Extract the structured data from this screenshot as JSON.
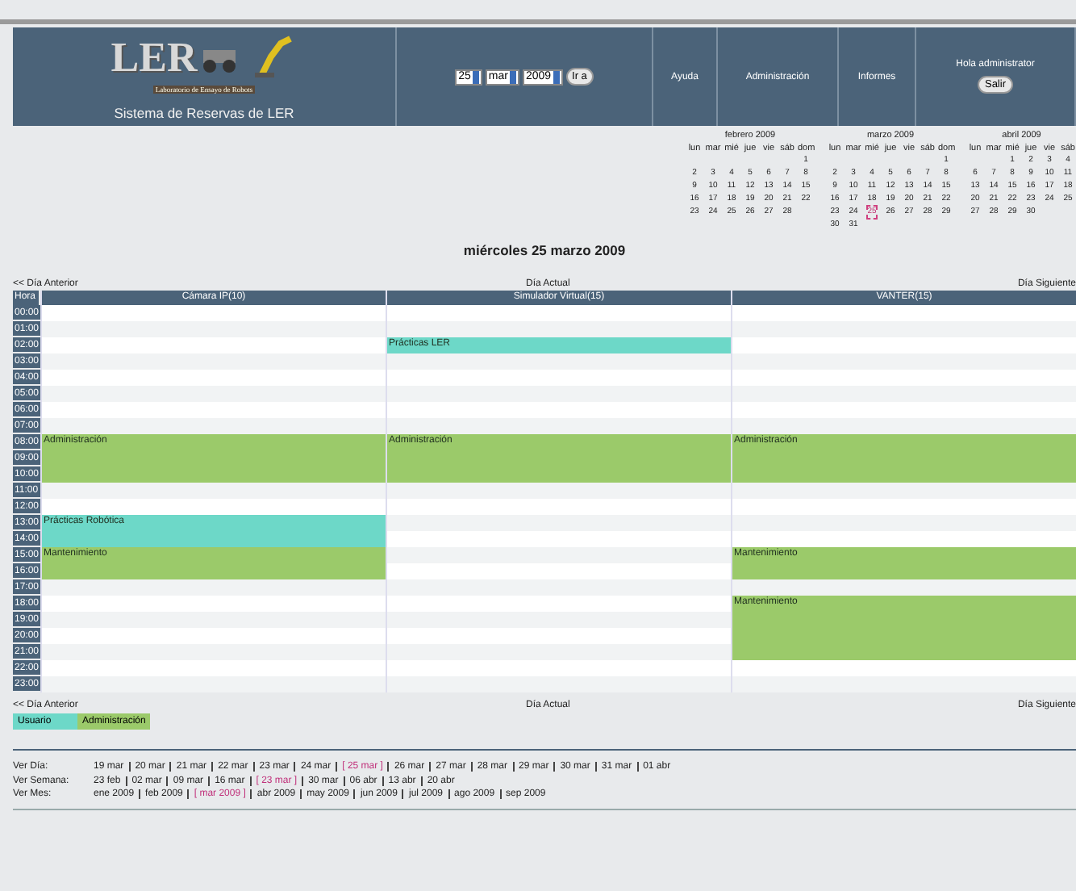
{
  "header": {
    "subtitle": "Sistema de Reservas de LER",
    "logo_text": "LER",
    "logo_caption": "Laboratorio de Ensayo de Robots",
    "date_picker": {
      "day": "25",
      "month": "mar",
      "year": "2009",
      "go": "Ir a"
    },
    "menu": [
      "Ayuda",
      "Administración",
      "Informes"
    ],
    "greeting": "Hola administrator",
    "logout": "Salir"
  },
  "calendars": [
    {
      "title": "febrero 2009",
      "weekdays": [
        "lun",
        "mar",
        "mié",
        "jue",
        "vie",
        "sáb",
        "dom"
      ],
      "weeks": [
        [
          {
            "day": "1",
            "selected": false
          }
        ],
        [
          {
            "day": "2",
            "selected": false
          },
          {
            "day": "3",
            "selected": false
          },
          {
            "day": "4",
            "selected": false
          },
          {
            "day": "5",
            "selected": false
          },
          {
            "day": "6",
            "selected": false
          },
          {
            "day": "7",
            "selected": false
          },
          {
            "day": "8",
            "selected": false
          }
        ],
        [
          {
            "day": "9",
            "selected": false
          },
          {
            "day": "10",
            "selected": false
          },
          {
            "day": "11",
            "selected": false
          },
          {
            "day": "12",
            "selected": false
          },
          {
            "day": "13",
            "selected": false
          },
          {
            "day": "14",
            "selected": false
          },
          {
            "day": "15",
            "selected": false
          }
        ],
        [
          {
            "day": "16",
            "selected": false
          },
          {
            "day": "17",
            "selected": false
          },
          {
            "day": "18",
            "selected": false
          },
          {
            "day": "19",
            "selected": false
          },
          {
            "day": "20",
            "selected": false
          },
          {
            "day": "21",
            "selected": false
          },
          {
            "day": "22",
            "selected": false
          }
        ],
        [
          {
            "day": "23",
            "selected": false
          },
          {
            "day": "24",
            "selected": false
          },
          {
            "day": "25",
            "selected": false
          },
          {
            "day": "26",
            "selected": false
          },
          {
            "day": "27",
            "selected": false
          },
          {
            "day": "28",
            "selected": false
          }
        ]
      ]
    },
    {
      "title": "marzo 2009",
      "weekdays": [
        "lun",
        "mar",
        "mié",
        "jue",
        "vie",
        "sáb",
        "dom"
      ],
      "weeks": [
        [
          {
            "day": "1",
            "selected": false
          }
        ],
        [
          {
            "day": "2",
            "selected": false
          },
          {
            "day": "3",
            "selected": false
          },
          {
            "day": "4",
            "selected": false
          },
          {
            "day": "5",
            "selected": false
          },
          {
            "day": "6",
            "selected": false
          },
          {
            "day": "7",
            "selected": false
          },
          {
            "day": "8",
            "selected": false
          }
        ],
        [
          {
            "day": "9",
            "selected": false
          },
          {
            "day": "10",
            "selected": false
          },
          {
            "day": "11",
            "selected": false
          },
          {
            "day": "12",
            "selected": false
          },
          {
            "day": "13",
            "selected": false
          },
          {
            "day": "14",
            "selected": false
          },
          {
            "day": "15",
            "selected": false
          }
        ],
        [
          {
            "day": "16",
            "selected": false
          },
          {
            "day": "17",
            "selected": false
          },
          {
            "day": "18",
            "selected": false
          },
          {
            "day": "19",
            "selected": false
          },
          {
            "day": "20",
            "selected": false
          },
          {
            "day": "21",
            "selected": false
          },
          {
            "day": "22",
            "selected": false
          }
        ],
        [
          {
            "day": "23",
            "selected": false
          },
          {
            "day": "24",
            "selected": false
          },
          {
            "day": "25",
            "selected": true
          },
          {
            "day": "26",
            "selected": false
          },
          {
            "day": "27",
            "selected": false
          },
          {
            "day": "28",
            "selected": false
          },
          {
            "day": "29",
            "selected": false
          }
        ],
        [
          {
            "day": "30",
            "selected": false
          },
          {
            "day": "31",
            "selected": false
          }
        ]
      ]
    },
    {
      "title": "abril 2009",
      "weekdays": [
        "lun",
        "mar",
        "mié",
        "jue",
        "vie",
        "sáb"
      ],
      "weeks": [
        [
          {
            "day": "1",
            "selected": false
          },
          {
            "day": "2",
            "selected": false
          },
          {
            "day": "3",
            "selected": false
          },
          {
            "day": "4",
            "selected": false
          }
        ],
        [
          {
            "day": "6",
            "selected": false
          },
          {
            "day": "7",
            "selected": false
          },
          {
            "day": "8",
            "selected": false
          },
          {
            "day": "9",
            "selected": false
          },
          {
            "day": "10",
            "selected": false
          },
          {
            "day": "11",
            "selected": false
          }
        ],
        [
          {
            "day": "13",
            "selected": false
          },
          {
            "day": "14",
            "selected": false
          },
          {
            "day": "15",
            "selected": false
          },
          {
            "day": "16",
            "selected": false
          },
          {
            "day": "17",
            "selected": false
          },
          {
            "day": "18",
            "selected": false
          }
        ],
        [
          {
            "day": "20",
            "selected": false
          },
          {
            "day": "21",
            "selected": false
          },
          {
            "day": "22",
            "selected": false
          },
          {
            "day": "23",
            "selected": false
          },
          {
            "day": "24",
            "selected": false
          },
          {
            "day": "25",
            "selected": false
          }
        ],
        [
          {
            "day": "27",
            "selected": false
          },
          {
            "day": "28",
            "selected": false
          },
          {
            "day": "29",
            "selected": false
          },
          {
            "day": "30",
            "selected": false
          }
        ]
      ]
    }
  ],
  "day_title": "miércoles 25 marzo 2009",
  "nav_top": {
    "prev": "<< Día Anterior",
    "today": "Día Actual",
    "next": "Día Siguiente"
  },
  "schedule": {
    "hour_heading": "Hora",
    "hours": [
      "00:00",
      "01:00",
      "02:00",
      "03:00",
      "04:00",
      "05:00",
      "06:00",
      "07:00",
      "08:00",
      "09:00",
      "10:00",
      "11:00",
      "12:00",
      "13:00",
      "14:00",
      "15:00",
      "16:00",
      "17:00",
      "18:00",
      "19:00",
      "20:00",
      "21:00",
      "22:00",
      "23:00"
    ],
    "resources": [
      {
        "name": "Cámara IP(10)",
        "slots": [
          {
            "kind": "free"
          },
          {
            "kind": "free"
          },
          {
            "kind": "free"
          },
          {
            "kind": "free"
          },
          {
            "kind": "free"
          },
          {
            "kind": "free"
          },
          {
            "kind": "free"
          },
          {
            "kind": "free"
          },
          {
            "kind": "admin",
            "label": "Administración"
          },
          {
            "kind": "admin",
            "continued": true
          },
          {
            "kind": "admin",
            "continued": true
          },
          {
            "kind": "free"
          },
          {
            "kind": "free"
          },
          {
            "kind": "user",
            "label": "Prácticas Robótica"
          },
          {
            "kind": "user",
            "continued": true
          },
          {
            "kind": "admin",
            "label": "Mantenimiento"
          },
          {
            "kind": "admin",
            "continued": true
          },
          {
            "kind": "free"
          },
          {
            "kind": "free"
          },
          {
            "kind": "free"
          },
          {
            "kind": "free"
          },
          {
            "kind": "free"
          },
          {
            "kind": "free"
          },
          {
            "kind": "free"
          }
        ]
      },
      {
        "name": "Simulador Virtual(15)",
        "slots": [
          {
            "kind": "free"
          },
          {
            "kind": "free"
          },
          {
            "kind": "user",
            "label": "Prácticas LER"
          },
          {
            "kind": "free"
          },
          {
            "kind": "free"
          },
          {
            "kind": "free"
          },
          {
            "kind": "free"
          },
          {
            "kind": "free"
          },
          {
            "kind": "admin",
            "label": "Administración"
          },
          {
            "kind": "admin",
            "continued": true
          },
          {
            "kind": "admin",
            "continued": true
          },
          {
            "kind": "free"
          },
          {
            "kind": "free"
          },
          {
            "kind": "free"
          },
          {
            "kind": "free"
          },
          {
            "kind": "free"
          },
          {
            "kind": "free"
          },
          {
            "kind": "free"
          },
          {
            "kind": "free"
          },
          {
            "kind": "free"
          },
          {
            "kind": "free"
          },
          {
            "kind": "free"
          },
          {
            "kind": "free"
          },
          {
            "kind": "free"
          }
        ]
      },
      {
        "name": "VANTER(15)",
        "slots": [
          {
            "kind": "free"
          },
          {
            "kind": "free"
          },
          {
            "kind": "free"
          },
          {
            "kind": "free"
          },
          {
            "kind": "free"
          },
          {
            "kind": "free"
          },
          {
            "kind": "free"
          },
          {
            "kind": "free"
          },
          {
            "kind": "admin",
            "label": "Administración"
          },
          {
            "kind": "admin",
            "continued": true
          },
          {
            "kind": "admin",
            "continued": true
          },
          {
            "kind": "free"
          },
          {
            "kind": "free"
          },
          {
            "kind": "free"
          },
          {
            "kind": "free"
          },
          {
            "kind": "admin",
            "label": "Mantenimiento"
          },
          {
            "kind": "admin",
            "continued": true
          },
          {
            "kind": "free"
          },
          {
            "kind": "admin",
            "label": "Mantenimiento"
          },
          {
            "kind": "admin",
            "continued": true
          },
          {
            "kind": "admin",
            "continued": true
          },
          {
            "kind": "admin",
            "continued": true
          },
          {
            "kind": "free"
          },
          {
            "kind": "free"
          }
        ]
      }
    ]
  },
  "nav_bottom": {
    "prev": "<< Día Anterior",
    "today": "Día Actual",
    "next": "Día Siguiente"
  },
  "legend": [
    {
      "kind": "user",
      "label": "Usuario"
    },
    {
      "kind": "admin",
      "label": "Administración"
    }
  ],
  "views": [
    {
      "label": "Ver Día:",
      "links": [
        {
          "text": "19 mar",
          "selected": false
        },
        {
          "text": "20 mar",
          "selected": false
        },
        {
          "text": "21 mar",
          "selected": false
        },
        {
          "text": "22 mar",
          "selected": false
        },
        {
          "text": "23 mar",
          "selected": false
        },
        {
          "text": "24 mar",
          "selected": false
        },
        {
          "text": "[ 25 mar ]",
          "selected": true
        },
        {
          "text": "26 mar",
          "selected": false
        },
        {
          "text": "27 mar",
          "selected": false
        },
        {
          "text": "28 mar",
          "selected": false
        },
        {
          "text": "29 mar",
          "selected": false
        },
        {
          "text": "30 mar",
          "selected": false
        },
        {
          "text": "31 mar",
          "selected": false
        },
        {
          "text": "01 abr",
          "selected": false
        }
      ]
    },
    {
      "label": "Ver Semana:",
      "links": [
        {
          "text": "23 feb",
          "selected": false
        },
        {
          "text": "02 mar",
          "selected": false
        },
        {
          "text": "09 mar",
          "selected": false
        },
        {
          "text": "16 mar",
          "selected": false
        },
        {
          "text": "[ 23 mar ]",
          "selected": true
        },
        {
          "text": "30 mar",
          "selected": false
        },
        {
          "text": "06 abr",
          "selected": false
        },
        {
          "text": "13 abr",
          "selected": false
        },
        {
          "text": "20 abr",
          "selected": false
        }
      ]
    },
    {
      "label": "Ver Mes:",
      "links": [
        {
          "text": "ene 2009",
          "selected": false
        },
        {
          "text": "feb 2009",
          "selected": false
        },
        {
          "text": "[ mar 2009 ]",
          "selected": true
        },
        {
          "text": "abr 2009",
          "selected": false
        },
        {
          "text": "may 2009",
          "selected": false
        },
        {
          "text": "jun 2009",
          "selected": false
        },
        {
          "text": "jul 2009",
          "selected": false
        },
        {
          "text": "ago 2009",
          "selected": false
        },
        {
          "text": "sep 2009",
          "selected": false
        }
      ]
    }
  ]
}
